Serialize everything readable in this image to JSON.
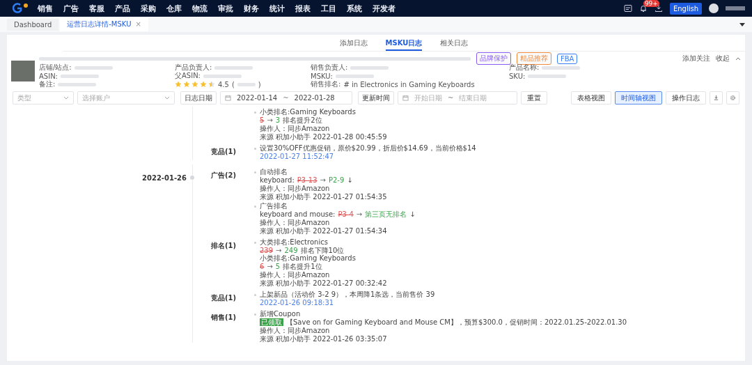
{
  "nav": {
    "menu": [
      "销售",
      "广告",
      "客服",
      "产品",
      "采购",
      "仓库",
      "物流",
      "审批",
      "财务",
      "统计",
      "报表",
      "工目",
      "系统",
      "开发者"
    ],
    "badge": "99+",
    "language": "English"
  },
  "page_tabs": [
    {
      "label": "Dashboard",
      "selected": false
    },
    {
      "label": "运营日志详情-MSKU",
      "selected": true,
      "close": "×"
    }
  ],
  "log_tabs": [
    {
      "label": "添加日志",
      "selected": false
    },
    {
      "label": "MSKU日志",
      "selected": true
    },
    {
      "label": "相关日志",
      "selected": false
    }
  ],
  "product": {
    "tags": [
      {
        "label": "品牌保护",
        "color": "#8a5cf6"
      },
      {
        "label": "精品推荐",
        "color": "#f08a3c"
      },
      {
        "label": "FBA",
        "color": "#3b82f6"
      }
    ],
    "follow": "添加关注",
    "collapse": "收起",
    "columns": [
      [
        {
          "label": "店铺/站点:"
        },
        {
          "label": "ASIN:"
        },
        {
          "label": "备注:"
        }
      ],
      [
        {
          "label": "产品负责人:"
        },
        {
          "label": "父ASIN:"
        },
        {
          "kind": "rating",
          "stars": 4.5,
          "score": "4.5",
          "open": "(",
          "close": ")"
        }
      ],
      [
        {
          "label": "销售负责人:"
        },
        {
          "label": "MSKU:"
        },
        {
          "label": "销售排名:",
          "value": "# in Electronics  in Gaming Keyboards"
        }
      ],
      [
        {
          "label": "产品名称:"
        },
        {
          "label": "SKU:"
        }
      ]
    ]
  },
  "filters": {
    "type_placeholder": "类型",
    "account_placeholder": "选择账户",
    "log_date_label": "日志日期",
    "log_date_from": "2022-01-14",
    "log_date_to": "2022-01-28",
    "separator": "~",
    "update_label": "更新时间",
    "update_from_placeholder": "开始日期",
    "update_to_placeholder": "结束日期",
    "reset": "重置",
    "views": [
      {
        "label": "表格视图",
        "selected": false
      },
      {
        "label": "时间轴视图",
        "selected": true
      },
      {
        "label": "操作日志",
        "selected": false
      }
    ]
  },
  "timeline": [
    {
      "groups": [
        {
          "entries": [
            {
              "lines": [
                {
                  "kind": "text",
                  "text": "小类排名:Gaming Keyboards"
                },
                {
                  "kind": "change",
                  "from": "5",
                  "arrow": "→",
                  "to": "3",
                  "note": "排名提升2位"
                }
              ],
              "operator": "操作人：同步Amazon",
              "source": "来源 积加小助手 2022-01-28 00:45:59"
            }
          ]
        },
        {
          "category": "竞品(1)",
          "entries": [
            {
              "lines": [
                {
                  "kind": "text",
                  "text": "设置30%OFF优惠促销，原价$20.99，折后价$14.69，当前价格$14"
                },
                {
                  "kind": "link",
                  "text": "2022-01-27 11:52:47"
                }
              ]
            }
          ]
        }
      ]
    },
    {
      "date": "2022-01-26",
      "groups": [
        {
          "category": "广告(2)",
          "entries": [
            {
              "lines": [
                {
                  "kind": "text",
                  "text": "自动排名"
                },
                {
                  "kind": "change",
                  "label": "keyboard:",
                  "from": "P3-13",
                  "arrow": "→",
                  "to": "P2-9",
                  "note": "↓"
                }
              ],
              "operator": "操作人：同步Amazon",
              "source": "来源 积加小助手 2022-01-27 01:54:35"
            },
            {
              "lines": [
                {
                  "kind": "text",
                  "text": "广告排名"
                },
                {
                  "kind": "change",
                  "label": "keyboard and mouse:",
                  "from": "P3-4",
                  "arrow": "→",
                  "to": "第三页无排名",
                  "note": "↓"
                }
              ],
              "operator": "操作人：同步Amazon",
              "source": "来源 积加小助手 2022-01-27 01:54:34"
            }
          ]
        },
        {
          "category": "排名(1)",
          "entries": [
            {
              "lines": [
                {
                  "kind": "text",
                  "text": "大类排名:Electronics"
                },
                {
                  "kind": "change",
                  "from": "239",
                  "arrow": "→",
                  "to": "249",
                  "note": "排名下降10位"
                },
                {
                  "kind": "text",
                  "text": "小类排名:Gaming Keyboards"
                },
                {
                  "kind": "change",
                  "from": "6",
                  "arrow": "→",
                  "to": "5",
                  "note": "排名提升1位"
                }
              ],
              "operator": "操作人：同步Amazon",
              "source": "来源 积加小助手 2022-01-27 00:32:42"
            }
          ]
        },
        {
          "category": "竞品(1)",
          "entries": [
            {
              "lines": [
                {
                  "kind": "text",
                  "text": "上架新品（活动价 3-2 9），本周降1条选，当前售价 39"
                },
                {
                  "kind": "link",
                  "text": "2022-01-26 09:18:31"
                }
              ]
            }
          ]
        },
        {
          "category": "销售(1)",
          "entries": [
            {
              "lines": [
                {
                  "kind": "text",
                  "text": "新增Coupon"
                },
                {
                  "kind": "coupon",
                  "status": "已领取",
                  "text": "【Save on for Gaming Keyboard and Mouse CM】，预算$300.0，促销时间：2022.01.25-2022.01.30"
                }
              ],
              "operator": "操作人：同步Amazon",
              "source": "来源 积加小助手 2022-01-26 03:35:07"
            }
          ]
        }
      ]
    }
  ]
}
